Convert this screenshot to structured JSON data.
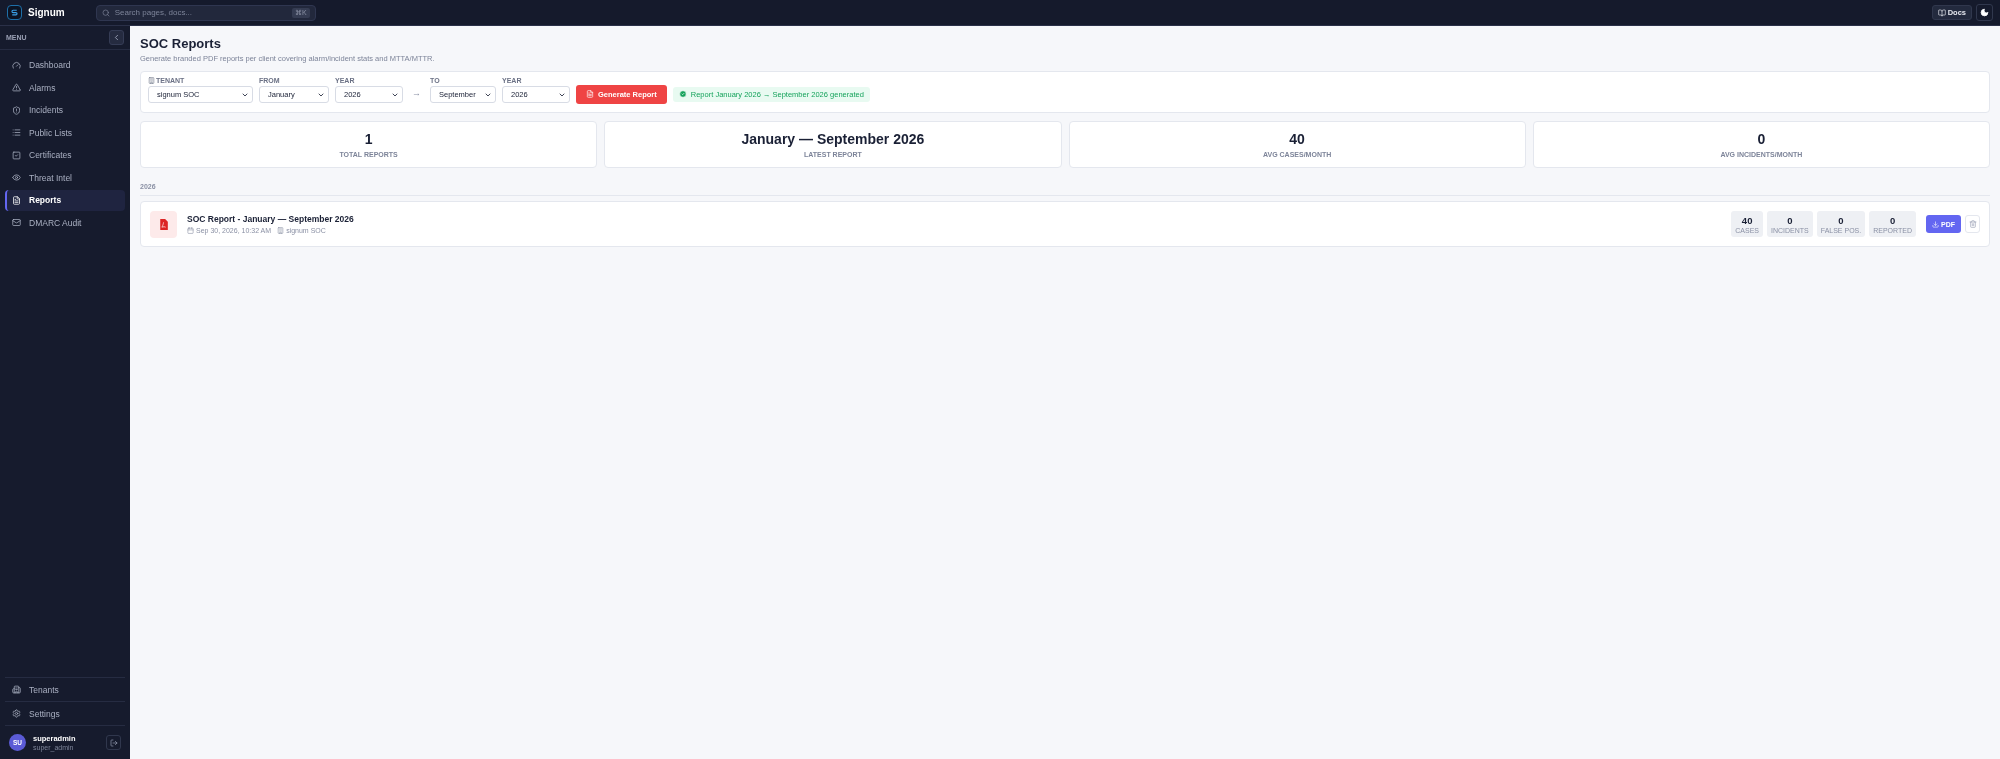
{
  "app": {
    "name": "Signum"
  },
  "header": {
    "search": {
      "placeholder": "Search pages, docs...",
      "shortcut": "⌘K"
    },
    "docs_button": "Docs"
  },
  "sidebar": {
    "menu_label": "MENU",
    "items": [
      {
        "label": "Dashboard",
        "selected": false
      },
      {
        "label": "Alarms",
        "selected": false
      },
      {
        "label": "Incidents",
        "selected": false
      },
      {
        "label": "Public Lists",
        "selected": false
      },
      {
        "label": "Certificates",
        "selected": false
      },
      {
        "label": "Threat Intel",
        "selected": false
      },
      {
        "label": "Reports",
        "selected": true
      },
      {
        "label": "DMARC Audit",
        "selected": false
      }
    ],
    "bottom_items": [
      {
        "label": "Tenants"
      },
      {
        "label": "Settings"
      }
    ],
    "user": {
      "initials": "SU",
      "name": "superadmin",
      "role": "super_admin"
    }
  },
  "page": {
    "title": "SOC Reports",
    "subtitle": "Generate branded PDF reports per client covering alarm/incident stats and MTTA/MTTR."
  },
  "filters": {
    "fields": [
      {
        "label": "TENANT",
        "value": "signum SOC"
      },
      {
        "label": "FROM",
        "value": "January"
      },
      {
        "label": "YEAR",
        "value": "2026"
      },
      {
        "label": "TO",
        "value": "September"
      },
      {
        "label": "YEAR",
        "value": "2026"
      }
    ],
    "arrow": "→",
    "generate_button": "Generate Report",
    "status": "Report January 2026 → September 2026 generated"
  },
  "stats": [
    {
      "value": "1",
      "label": "TOTAL REPORTS"
    },
    {
      "value": "January — September 2026",
      "label": "LATEST REPORT"
    },
    {
      "value": "40",
      "label": "AVG CASES/MONTH"
    },
    {
      "value": "0",
      "label": "AVG INCIDENTS/MONTH"
    }
  ],
  "sections": [
    {
      "year": "2026",
      "reports": [
        {
          "title": "SOC Report - January — September 2026",
          "date": "Sep 30, 2026, 10:32 AM",
          "tenant": "signum SOC",
          "counts": [
            {
              "value": "40",
              "label": "CASES"
            },
            {
              "value": "0",
              "label": "INCIDENTS"
            },
            {
              "value": "0",
              "label": "FALSE POS."
            },
            {
              "value": "0",
              "label": "REPORTED"
            }
          ],
          "download_label": "PDF"
        }
      ]
    }
  ]
}
